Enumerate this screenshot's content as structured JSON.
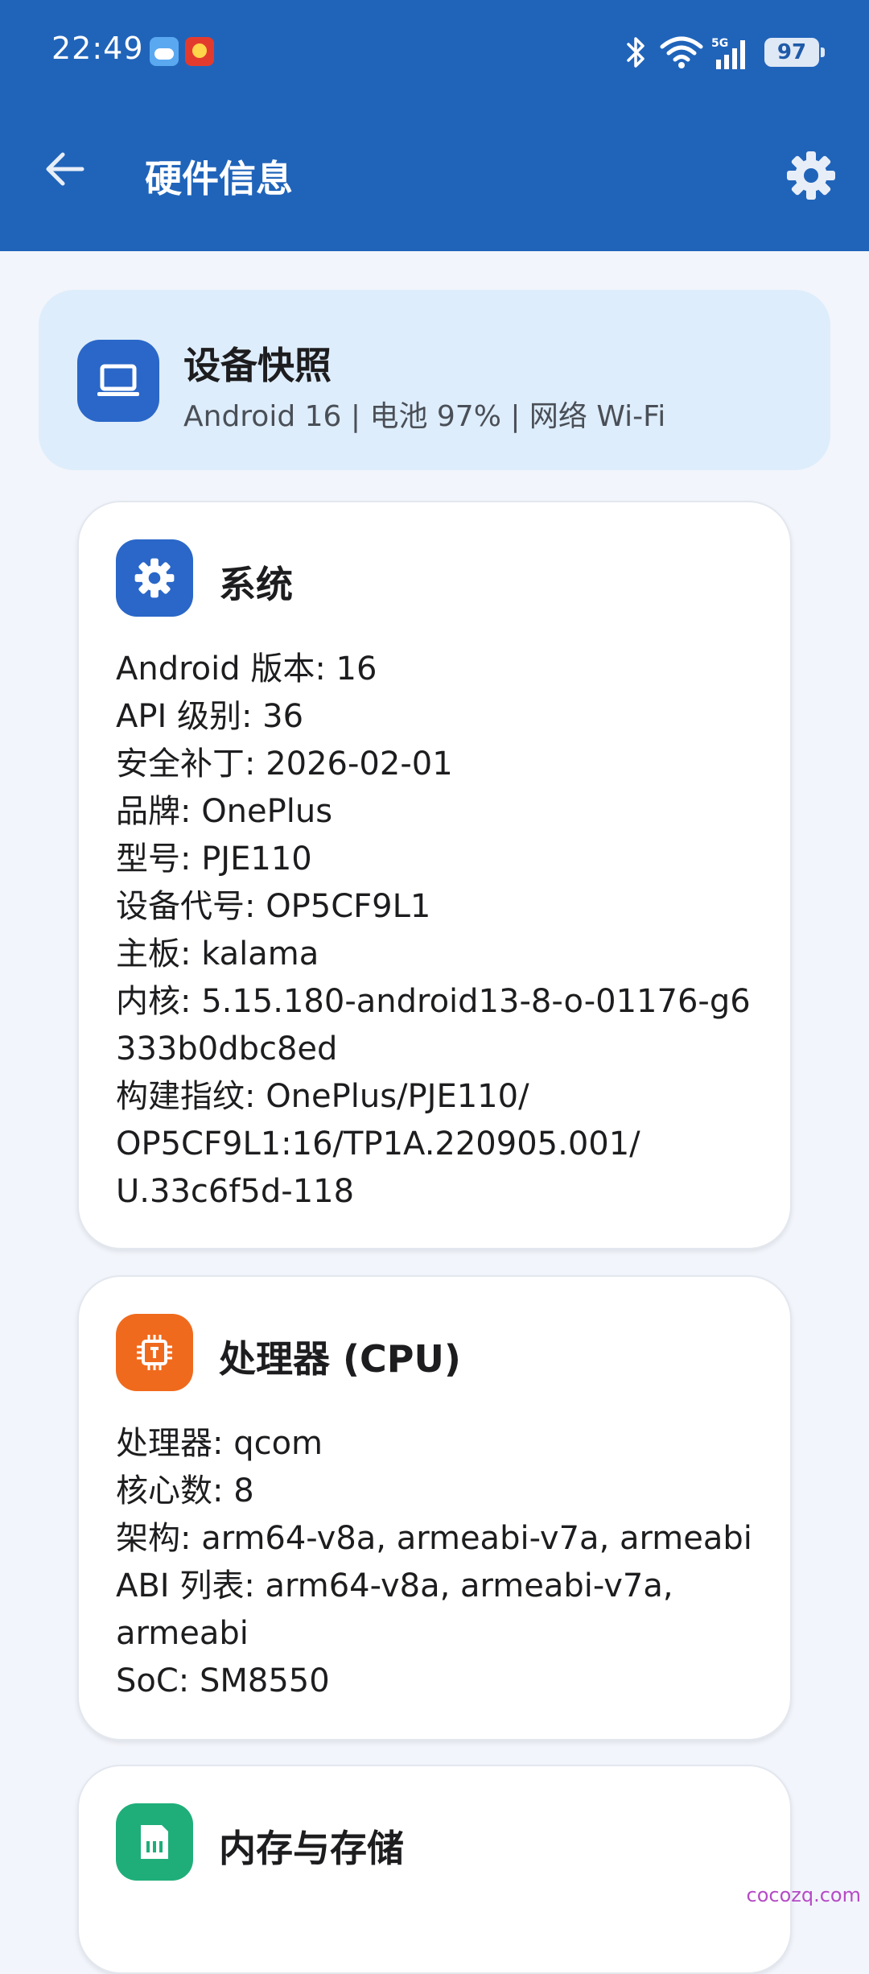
{
  "status_bar": {
    "time": "22:49",
    "battery": "97",
    "icons": [
      "weather-icon",
      "app-notification-icon",
      "bluetooth-icon",
      "wifi-icon",
      "5g-signal-icon",
      "battery-icon"
    ]
  },
  "toolbar": {
    "title": "硬件信息",
    "back_icon": "arrow-back-icon",
    "settings_icon": "gear-icon",
    "background_color": "#2064ba"
  },
  "snapshot": {
    "title": "设备快照",
    "subtitle": "Android 16 | 电池 97% | 网络 Wi-Fi",
    "icon": "laptop-icon",
    "background_color": "#deedfb"
  },
  "sections": {
    "system": {
      "title": "系统",
      "icon": "gear-icon",
      "icon_color": "#2a67c8",
      "lines": [
        "Android 版本: 16",
        "API 级别: 36",
        "安全补丁: 2026-02-01",
        "品牌: OnePlus",
        "型号: PJE110",
        "设备代号: OP5CF9L1",
        "主板: kalama",
        "内核: 5.15.180-android13-8-o-01176-g6",
        "333b0dbc8ed",
        "构建指纹: OnePlus/PJE110/",
        "OP5CF9L1:16/TP1A.220905.001/",
        "U.33c6f5d-118"
      ]
    },
    "cpu": {
      "title": "处理器 (CPU)",
      "icon": "chip-icon",
      "icon_color": "#f06a1d",
      "lines": [
        "处理器: qcom",
        "核心数: 8",
        "架构: arm64-v8a, armeabi-v7a, armeabi",
        "ABI 列表: arm64-v8a, armeabi-v7a,",
        "armeabi",
        "SoC: SM8550"
      ]
    },
    "memory": {
      "title": "内存与存储",
      "icon": "sd-card-icon",
      "icon_color": "#1fae7a"
    }
  },
  "watermark": "cocozq.com"
}
